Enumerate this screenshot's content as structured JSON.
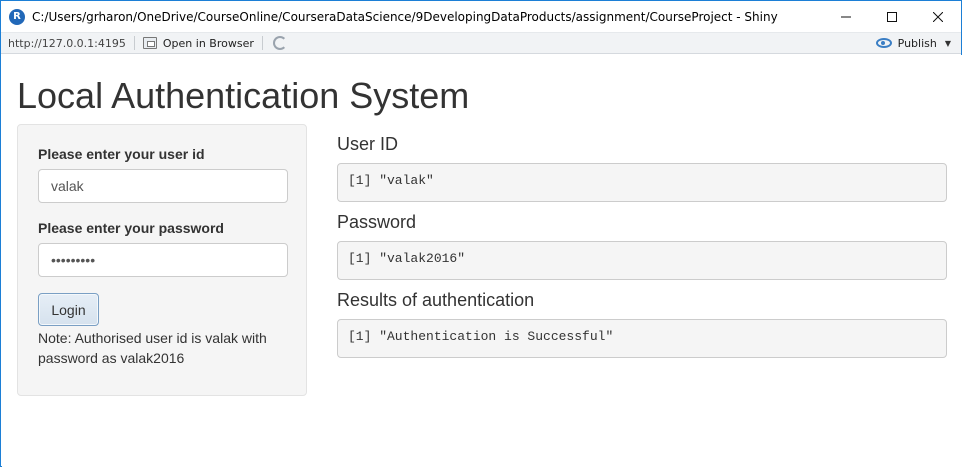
{
  "window": {
    "title": "C:/Users/grharon/OneDrive/CourseOnline/CourseraDataScience/9DevelopingDataProducts/assignment/CourseProject - Shiny",
    "icon_letter": "R"
  },
  "toolbar": {
    "url": "http://127.0.0.1:4195",
    "open_in_browser": "Open in Browser",
    "publish": "Publish"
  },
  "app": {
    "title": "Local Authentication System",
    "user_id_label": "Please enter your user id",
    "user_id_value": "valak",
    "password_label": "Please enter your password",
    "password_value": "valak2016",
    "login_label": "Login",
    "note": "Note: Authorised user id is valak with password as valak2016",
    "outputs": [
      {
        "heading": "User ID",
        "value": "[1] \"valak\""
      },
      {
        "heading": "Password",
        "value": "[1] \"valak2016\""
      },
      {
        "heading": "Results of authentication",
        "value": "[1] \"Authentication is Successful\""
      }
    ]
  },
  "colors": {
    "window_border": "#1c7fd6",
    "sidebar_bg": "#f5f5f5",
    "button_border": "#7a9fc4"
  }
}
